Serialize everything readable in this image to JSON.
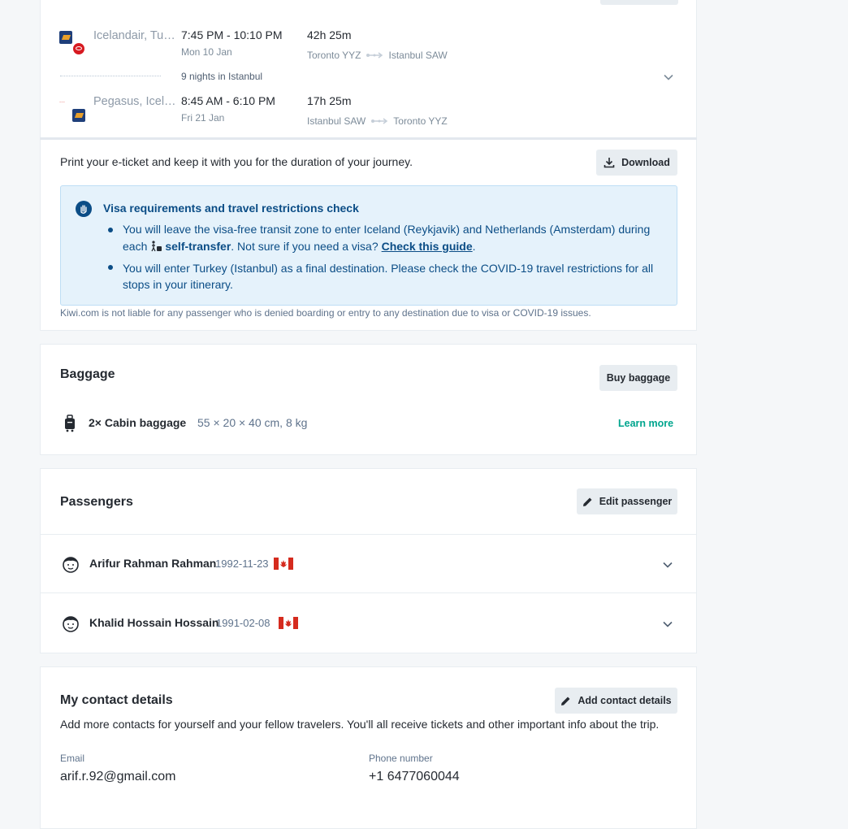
{
  "itinerary": {
    "outbound": {
      "carrier": "Icelandair, Tu…",
      "times": "7:45 PM - 10:10 PM",
      "date": "Mon 10 Jan",
      "duration": "42h 25m",
      "from": "Toronto YYZ",
      "to": "Istanbul SAW"
    },
    "stay_label": "9 nights in Istanbul",
    "inbound": {
      "carrier": "Pegasus, Icel…",
      "times": "8:45 AM - 6:10 PM",
      "date": "Fri 21 Jan",
      "duration": "17h 25m",
      "from": "Istanbul SAW",
      "to": "Toronto YYZ"
    }
  },
  "ticket": {
    "print_text": "Print your e-ticket and keep it with you for the duration of your journey.",
    "download_label": "Download",
    "visa": {
      "title": "Visa requirements and travel restrictions check",
      "bullet1_part1": "You will leave the visa-free transit zone to enter Iceland (Reykjavik) and Netherlands (Amsterdam) during",
      "bullet1_each": "each",
      "bullet1_self_transfer": "self-transfer",
      "bullet1_not_sure": ". Not sure if you need a visa?",
      "bullet1_link": "Check this guide",
      "bullet1_end": ".",
      "bullet2": "You will enter Turkey (Istanbul) as a final destination. Please check the COVID-19 travel restrictions for all stops in your itinerary."
    },
    "disclaimer": "Kiwi.com is not liable for any passenger who is denied boarding or entry to any destination due to visa or COVID-19 issues."
  },
  "baggage": {
    "title": "Baggage",
    "buy_label": "Buy baggage",
    "item_name": "2× Cabin baggage",
    "item_dims": "55 × 20 × 40 cm, 8 kg",
    "learn_more": "Learn more"
  },
  "passengers": {
    "title": "Passengers",
    "edit_label": "Edit passenger",
    "list": [
      {
        "name": "Arifur Rahman Rahman",
        "dob": "1992-11-23"
      },
      {
        "name": "Khalid Hossain Hossain",
        "dob": "1991-02-08"
      }
    ]
  },
  "contact": {
    "title": "My contact details",
    "add_label": "Add contact details",
    "description": "Add more contacts for yourself and your fellow travelers. You'll all receive tickets and other important info about the trip.",
    "email_label": "Email",
    "email_value": "arif.r.92@gmail.com",
    "phone_label": "Phone number",
    "phone_value": "+1 6477060044"
  },
  "colors": {
    "link_green": "#00a58e",
    "info_bg": "#e5f2fb",
    "info_text": "#0b4d86"
  }
}
